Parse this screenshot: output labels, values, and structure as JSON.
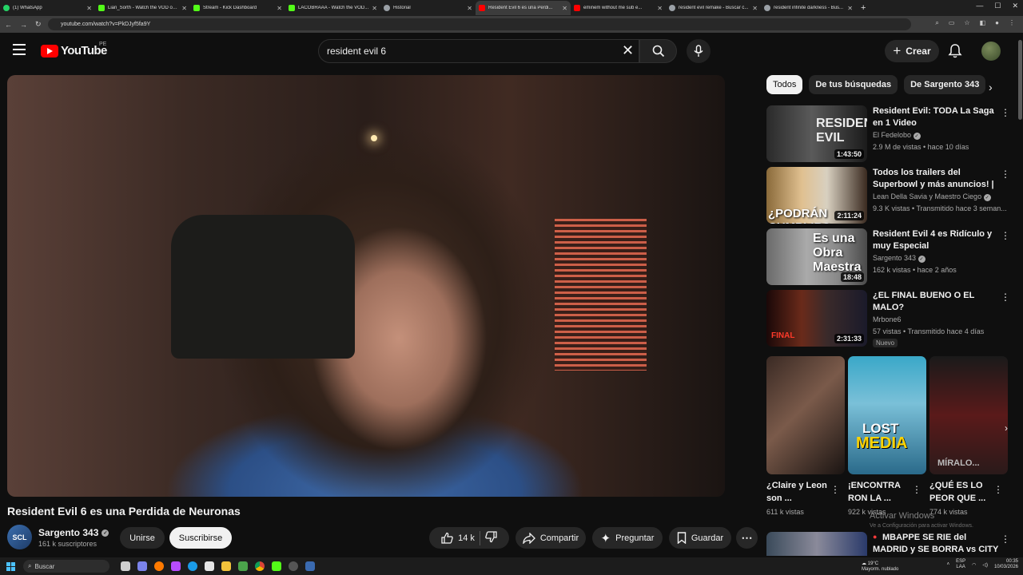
{
  "browser": {
    "tabs": [
      {
        "label": "(1) WhatsApp",
        "color": "#25d366"
      },
      {
        "label": "Lian_Sorth - Watch the VOD on...",
        "color": "#53fc18"
      },
      {
        "label": "Stream - Kick Dashboard",
        "color": "#53fc18"
      },
      {
        "label": "LACOBRAAA - Watch the VOD...",
        "color": "#53fc18"
      },
      {
        "label": "Historial",
        "color": "#9aa0a6"
      },
      {
        "label": "Resident Evil 6 es una Perdi...",
        "color": "#ff0000"
      },
      {
        "label": "eminem without me sub e...",
        "color": "#ff0000"
      },
      {
        "label": "resident evil remake - Buscar c...",
        "color": "#9aa0a6"
      },
      {
        "label": "resident infinite darkness - Bus...",
        "color": "#9aa0a6"
      }
    ],
    "active_tab_index": 5,
    "url": "youtube.com/watch?v=PkDJyf5fa9Y"
  },
  "header": {
    "logo_text": "YouTube",
    "country_code": "PE",
    "search_value": "resident evil 6",
    "create_label": "Crear"
  },
  "video": {
    "title": "Resident Evil 6 es una Perdida de Neuronas",
    "channel_initials": "SCL",
    "channel_name": "Sargento 343",
    "subscribers": "161 k suscriptores",
    "join_label": "Unirse",
    "subscribe_label": "Suscribirse",
    "likes": "14 k",
    "share_label": "Compartir",
    "ask_label": "Preguntar",
    "save_label": "Guardar"
  },
  "chips": [
    "Todos",
    "De tus búsquedas",
    "De Sargento 343"
  ],
  "recommendations": [
    {
      "title": "Resident Evil: TODA La Saga en 1 Video",
      "channel": "El Fedelobo",
      "meta": "2.9 M de vistas • hace 10 días",
      "duration": "1:43:50",
      "badge": ""
    },
    {
      "title": "Todos los trailers del Superbowl y más anuncios! | Mate a Cieg...",
      "channel": "Lean Della Savia  y Maestro Ciego",
      "meta": "9.3 K vistas • Transmitido hace 3 seman...",
      "duration": "2:11:24",
      "badge": ""
    },
    {
      "title": "Resident Evil 4 es Ridículo y muy Especial",
      "channel": "Sargento 343",
      "meta": "162 k vistas • hace 2 años",
      "duration": "18:48",
      "badge": ""
    },
    {
      "title": "¿EL FINAL BUENO O EL MALO?",
      "channel": "Mrbone6",
      "meta": "57 vistas • Transmitido hace 4 días",
      "duration": "2:31:33",
      "badge": "Nuevo"
    }
  ],
  "shorts": [
    {
      "title": "¿Claire y Leon son ...",
      "views": "611 k vistas"
    },
    {
      "title": "¡ENCONTRA RON LA ...",
      "views": "922 k vistas"
    },
    {
      "title": "¿QUÉ ES LO PEOR QUE ...",
      "views": "774 k vistas"
    }
  ],
  "last_rec": {
    "title": "MBAPPE SE RIE del MADRID y SE BORRA vs CITY - MESSI ..."
  },
  "windows_watermark": {
    "title": "Activar Windows",
    "subtitle": "Ve a Configuración para activar Windows."
  },
  "taskbar": {
    "search_label": "Buscar",
    "weather_temp": "19°C",
    "weather_desc": "Mayorm. nublado",
    "lang": "ESP",
    "lang2": "LAA",
    "time": "00:35",
    "date": "10/03/2026"
  }
}
